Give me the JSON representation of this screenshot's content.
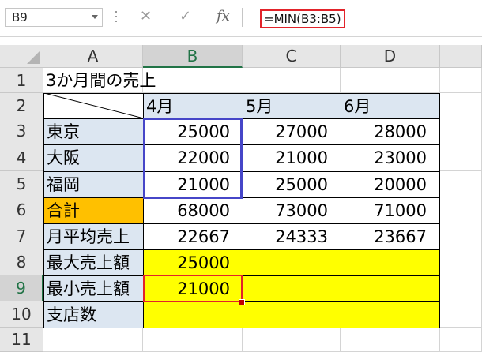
{
  "formula_bar": {
    "name_box": "B9",
    "cancel_symbol": "✕",
    "enter_symbol": "✓",
    "function_symbol": "fx",
    "formula": "=MIN(B3:B5)"
  },
  "columns": [
    "A",
    "B",
    "C",
    "D"
  ],
  "rows": [
    "1",
    "2",
    "3",
    "4",
    "5",
    "6",
    "7",
    "8",
    "9",
    "10",
    "11"
  ],
  "sheet": {
    "title": "3か月間の売上",
    "months": [
      "4月",
      "5月",
      "6月"
    ],
    "branches": [
      {
        "name": "東京",
        "values": [
          "25000",
          "27000",
          "28000"
        ]
      },
      {
        "name": "大阪",
        "values": [
          "22000",
          "21000",
          "23000"
        ]
      },
      {
        "name": "福岡",
        "values": [
          "21000",
          "25000",
          "20000"
        ]
      }
    ],
    "total": {
      "label": "合計",
      "values": [
        "68000",
        "73000",
        "71000"
      ]
    },
    "average": {
      "label": "月平均売上",
      "values": [
        "22667",
        "24333",
        "23667"
      ]
    },
    "max": {
      "label": "最大売上額",
      "value": "25000"
    },
    "min": {
      "label": "最小売上額",
      "value": "21000"
    },
    "count": {
      "label": "支店数"
    }
  },
  "colors": {
    "header_fill": "#dce6f1",
    "total_fill": "#ffc000",
    "stat_fill": "#ffff00",
    "range_highlight": "#4646c8",
    "selection": "#e2232a",
    "excel_green": "#217346"
  }
}
